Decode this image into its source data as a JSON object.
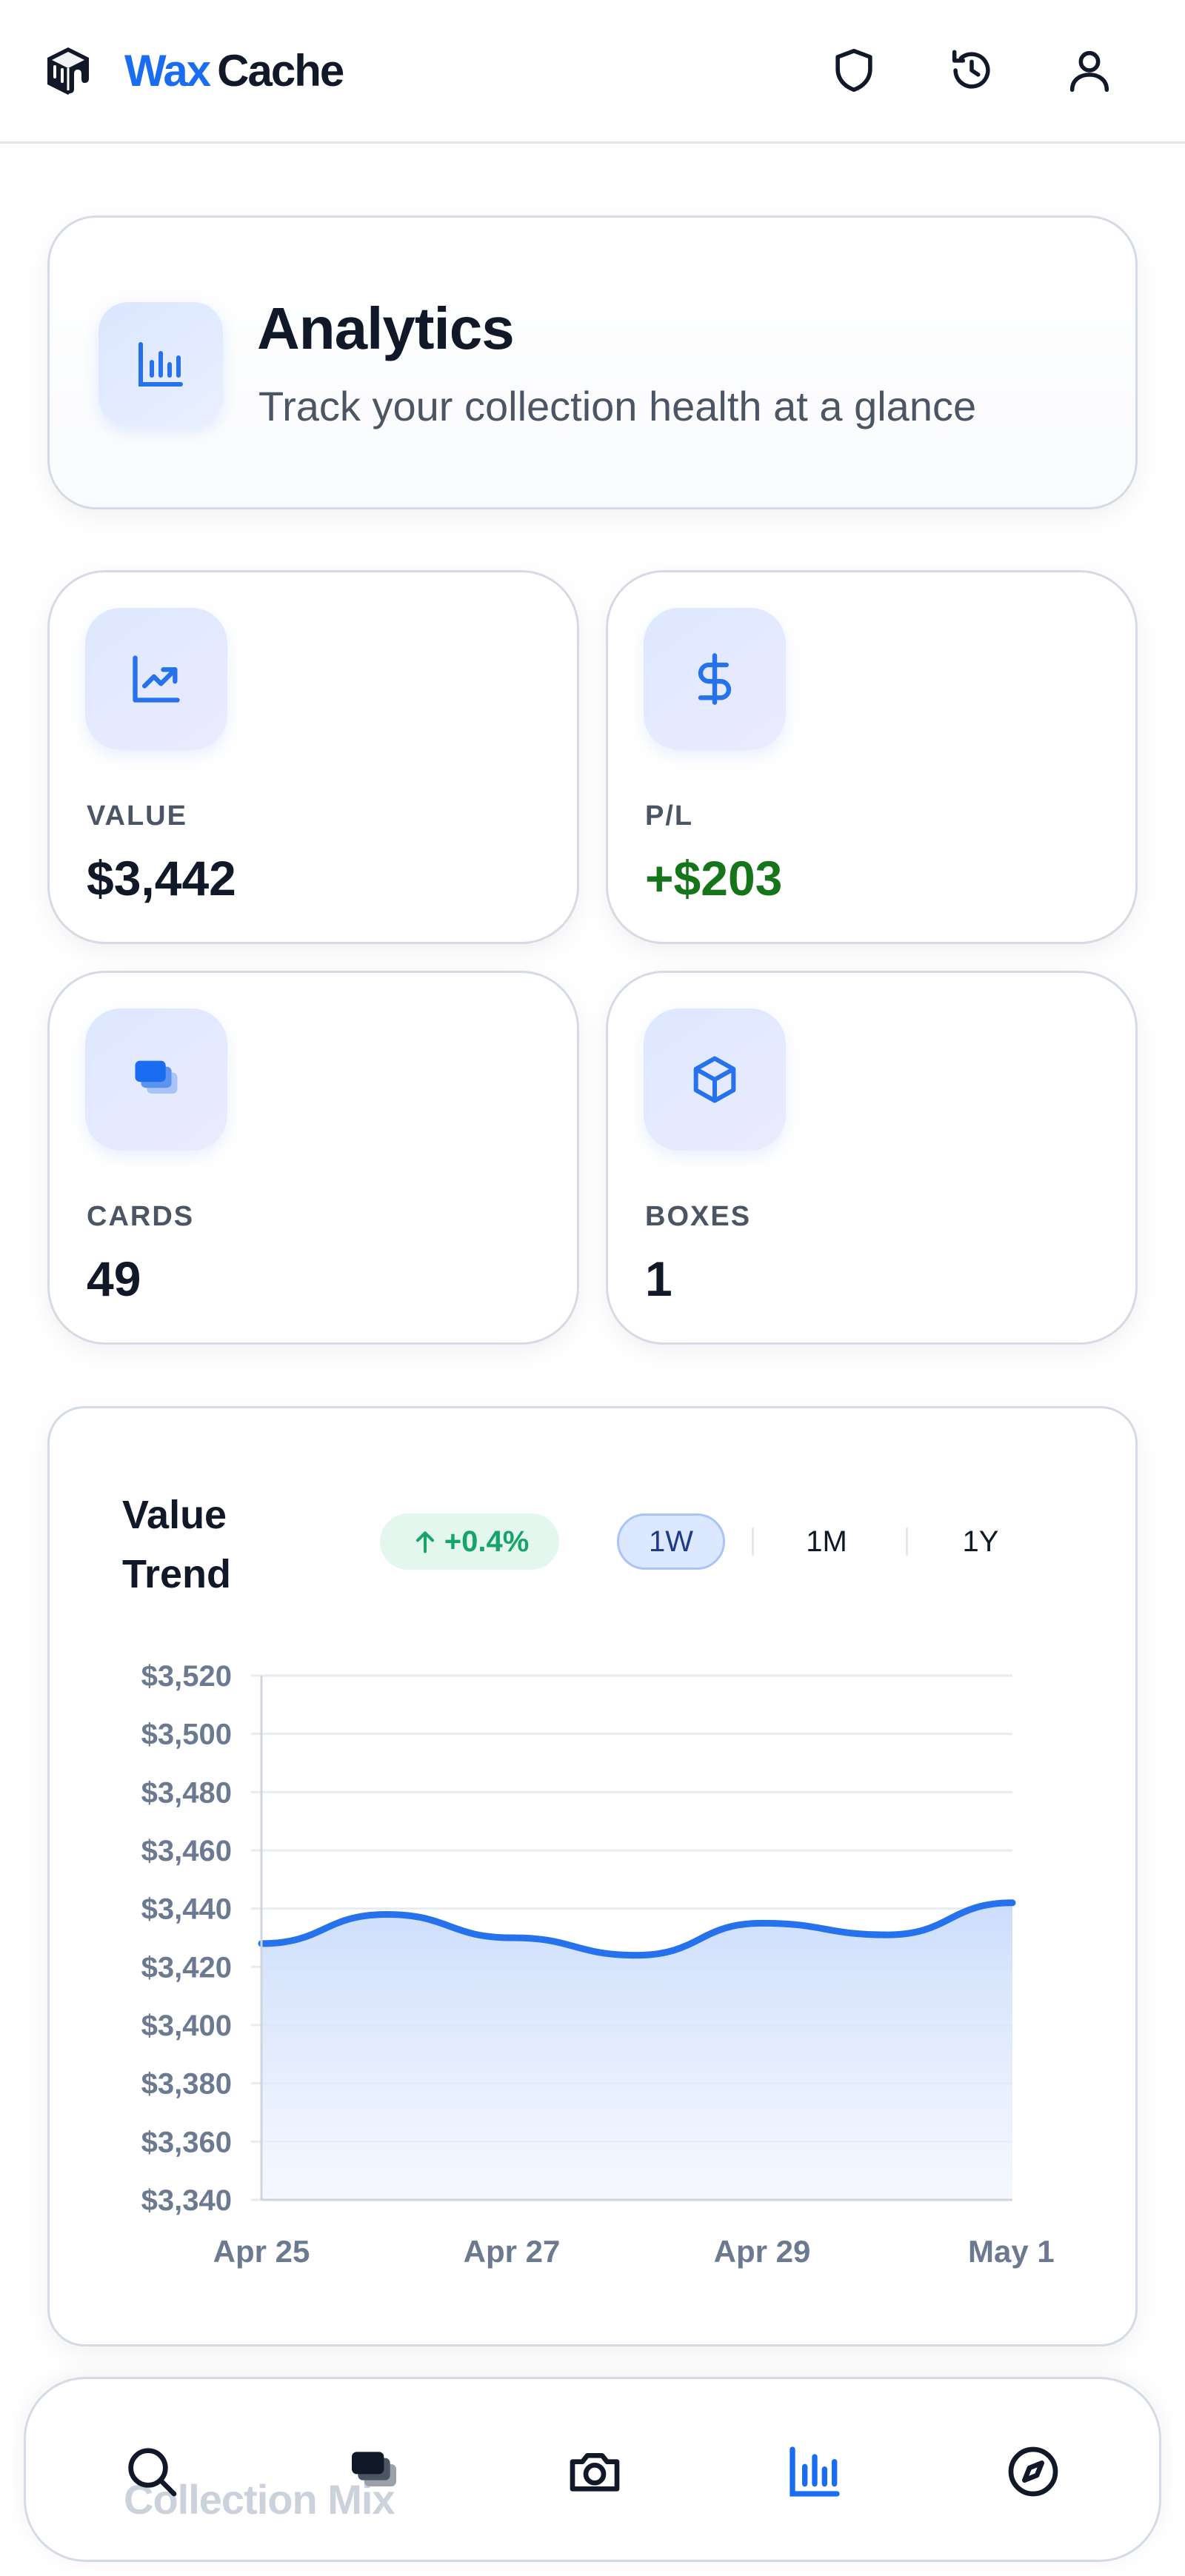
{
  "header": {
    "brand_part1": "Wax",
    "brand_part2": "Cache",
    "icons": [
      "drip-cube-logo-icon",
      "shield-icon",
      "history-icon",
      "user-icon"
    ]
  },
  "title_card": {
    "title": "Analytics",
    "subtitle": "Track your collection health at a glance",
    "icon": "bar-chart-icon"
  },
  "stats": [
    {
      "label": "VALUE",
      "value": "$3,442",
      "icon": "trending-up-icon"
    },
    {
      "label": "P/L",
      "value": "+$203",
      "icon": "dollar-icon"
    },
    {
      "label": "CARDS",
      "value": "49",
      "icon": "stacked-cards-icon"
    },
    {
      "label": "BOXES",
      "value": "1",
      "icon": "box-icon"
    }
  ],
  "chart_header": {
    "title": "Value Trend",
    "trend": "+0.4%",
    "ranges": [
      "1W",
      "1M",
      "1Y"
    ],
    "active_range": "1W"
  },
  "chart_data": {
    "type": "area",
    "title": "Value Trend",
    "x": [
      "Apr 25",
      "Apr 26",
      "Apr 27",
      "Apr 28",
      "Apr 29",
      "Apr 30",
      "May 1"
    ],
    "values": [
      3428,
      3438,
      3430,
      3424,
      3435,
      3431,
      3442
    ],
    "x_tick_labels": [
      "Apr 25",
      "Apr 27",
      "Apr 29",
      "May 1"
    ],
    "y_tick_labels": [
      "$3,520",
      "$3,500",
      "$3,480",
      "$3,460",
      "$3,440",
      "$3,420",
      "$3,400",
      "$3,380",
      "$3,360",
      "$3,340"
    ],
    "ylim": [
      3340,
      3520
    ],
    "grid": true,
    "colors": {
      "line": "#2672ec",
      "fill": "#dbe7fd"
    }
  },
  "bottom_peek": {
    "title": "Collection Mix"
  },
  "bottom_nav": {
    "items": [
      "search-icon",
      "cards-icon",
      "camera-icon",
      "analytics-icon",
      "compass-icon"
    ],
    "active": "analytics-icon"
  },
  "colors": {
    "accent": "#1a6cf0",
    "positive": "#15751b",
    "trend_green": "#16a46a"
  }
}
